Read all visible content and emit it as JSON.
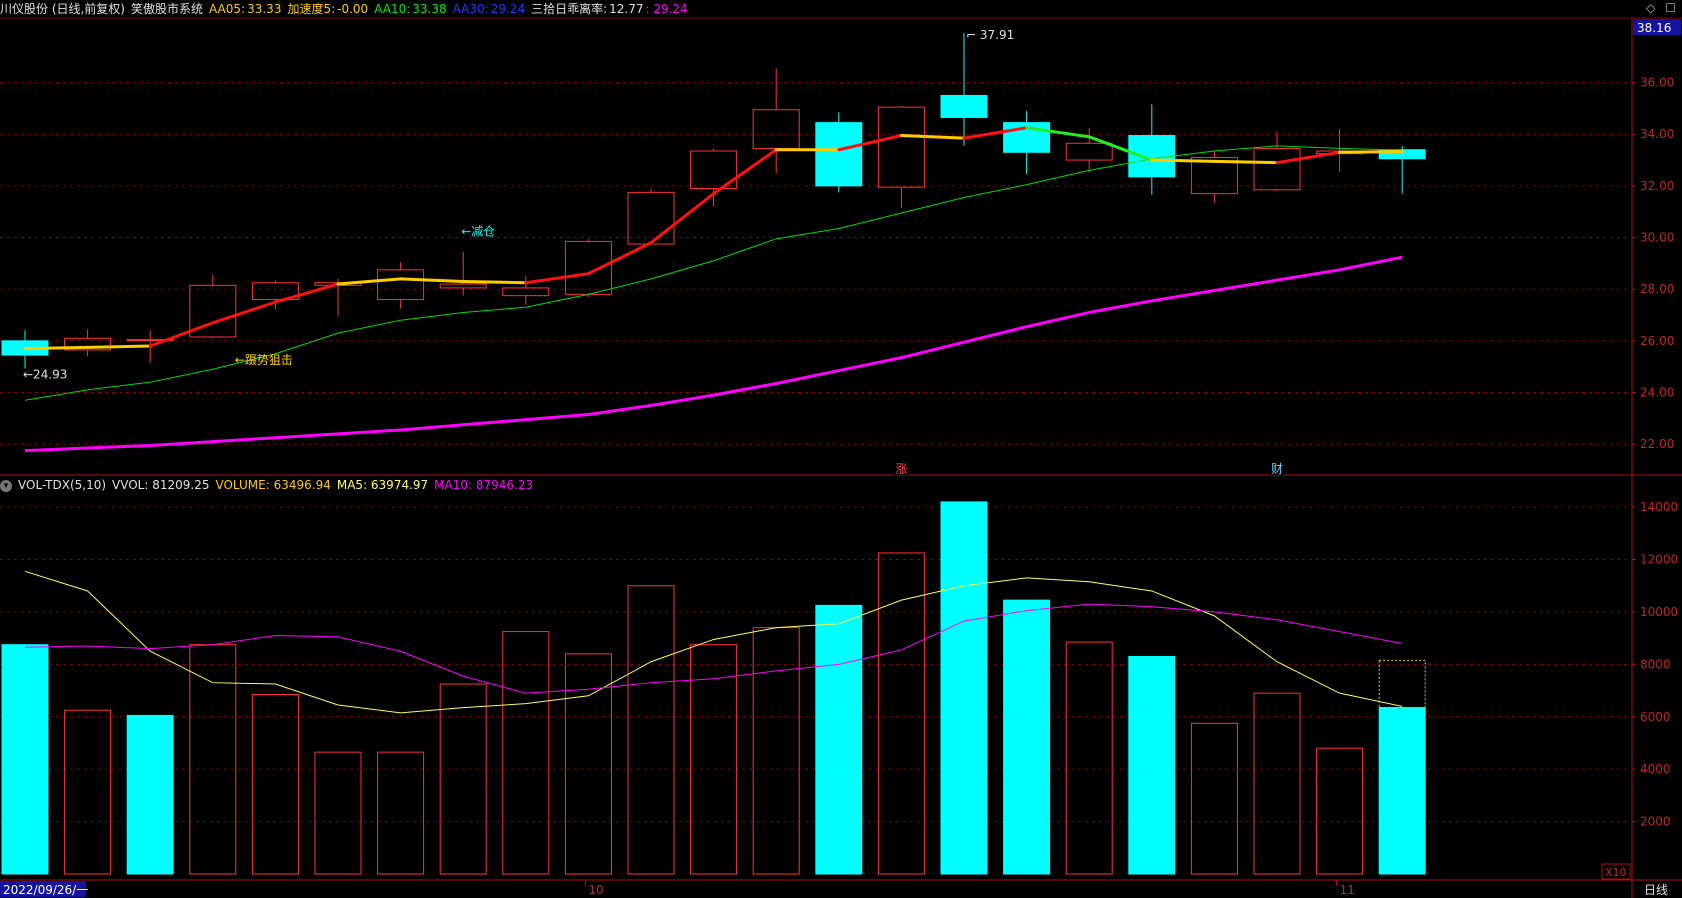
{
  "header": {
    "stock": "川仪股份 (日线,前复权)",
    "system": "笑傲股市系统",
    "aa05_label": "AA05:",
    "aa05": "33.33",
    "speed_label": "加速度5:",
    "speed": "-0.00",
    "aa10_label": "AA10:",
    "aa10": "33.38",
    "aa30_label": "AA30:",
    "aa30": "29.24",
    "bias_label": "三拾日乖离率:",
    "bias": "12.77",
    "bias2": ": 29.24",
    "icons": [
      "diamond-icon",
      "square-icon"
    ]
  },
  "volume_header": {
    "name": "VOL-TDX(5,10)",
    "vvol": "VVOL: 81209.25",
    "volume": "VOLUME: 63496.94",
    "ma5": "MA5: 63974.97",
    "ma10": "MA10: 87946.23"
  },
  "colors": {
    "up": "#ff3232",
    "down": "#00ffff",
    "ma5_line": "#ffcc00",
    "ma10_line": "#00dd00",
    "ma30_line": "#ff00ff",
    "grid": "#8b0000",
    "axis_text": "#c0281e"
  },
  "chart_data": [
    {
      "type": "candlestick",
      "title": "川仪股份 (日线,前复权)",
      "ylim": [
        21,
        38.5
      ],
      "y_ticks": [
        "22.00",
        "24.00",
        "26.00",
        "28.00",
        "30.00",
        "32.00",
        "34.00",
        "36.00"
      ],
      "last_price_tag": "38.16",
      "annotations": [
        {
          "text": "←24.93",
          "index": 0,
          "value": 24.93
        },
        {
          "text": "37.91",
          "index": 15,
          "value": 37.91
        },
        {
          "text": "←蹑势狙击",
          "index": 3,
          "value": 25.8
        },
        {
          "text": "←减仓",
          "index": 7,
          "value": 30.0
        },
        {
          "text": "涨",
          "index": 14,
          "value": 21.4
        },
        {
          "text": "财",
          "index": 20,
          "value": 21.4
        }
      ],
      "candles": [
        {
          "date": "2022/09/26",
          "open": 26.0,
          "close": 25.45,
          "high": 26.4,
          "low": 24.93
        },
        {
          "open": 25.65,
          "close": 26.1,
          "high": 26.45,
          "low": 25.4
        },
        {
          "open": 26.05,
          "close": 26.05,
          "high": 26.4,
          "low": 25.15
        },
        {
          "open": 26.15,
          "close": 28.15,
          "high": 28.55,
          "low": 26.1
        },
        {
          "open": 27.6,
          "close": 28.25,
          "high": 28.35,
          "low": 27.2
        },
        {
          "open": 28.15,
          "close": 28.25,
          "high": 28.4,
          "low": 26.95
        },
        {
          "open": 27.6,
          "close": 28.75,
          "high": 29.05,
          "low": 27.25
        },
        {
          "open": 28.05,
          "close": 28.2,
          "high": 29.45,
          "low": 27.75
        },
        {
          "open": 27.75,
          "close": 28.05,
          "high": 28.5,
          "low": 27.4
        },
        {
          "date": "10",
          "open": 27.8,
          "close": 29.85,
          "high": 29.95,
          "low": 27.7
        },
        {
          "open": 29.75,
          "close": 31.75,
          "high": 31.9,
          "low": 29.75
        },
        {
          "open": 31.9,
          "close": 33.35,
          "high": 33.45,
          "low": 31.2
        },
        {
          "open": 33.45,
          "close": 34.95,
          "high": 36.55,
          "low": 32.5
        },
        {
          "open": 34.45,
          "close": 32.0,
          "high": 34.85,
          "low": 31.75
        },
        {
          "open": 31.95,
          "close": 35.05,
          "high": 35.1,
          "low": 31.15
        },
        {
          "open": 35.5,
          "close": 34.65,
          "high": 37.91,
          "low": 33.55
        },
        {
          "open": 34.45,
          "close": 33.3,
          "high": 34.9,
          "low": 32.45
        },
        {
          "open": 33.0,
          "close": 33.65,
          "high": 34.25,
          "low": 32.55
        },
        {
          "open": 33.95,
          "close": 32.35,
          "high": 35.15,
          "low": 31.65
        },
        {
          "open": 31.7,
          "close": 33.1,
          "high": 33.35,
          "low": 31.35
        },
        {
          "open": 31.85,
          "close": 33.45,
          "high": 34.1,
          "low": 31.8
        },
        {
          "date": "11",
          "open": 33.25,
          "close": 33.35,
          "high": 34.2,
          "low": 32.55
        },
        {
          "open": 33.4,
          "close": 33.05,
          "high": 33.55,
          "low": 31.7
        }
      ],
      "series": [
        {
          "name": "AA05",
          "values": [
            25.7,
            25.75,
            25.8,
            26.7,
            27.5,
            28.2,
            28.4,
            28.3,
            28.25,
            28.6,
            29.8,
            31.7,
            33.4,
            33.4,
            33.95,
            33.85,
            34.25,
            33.9,
            33.0,
            32.95,
            32.9,
            33.3,
            33.33
          ]
        },
        {
          "name": "AA10",
          "values": [
            23.7,
            24.1,
            24.4,
            24.9,
            25.5,
            26.3,
            26.8,
            27.1,
            27.3,
            27.8,
            28.4,
            29.1,
            29.95,
            30.35,
            30.95,
            31.55,
            32.05,
            32.6,
            33.05,
            33.35,
            33.55,
            33.45,
            33.38
          ]
        },
        {
          "name": "AA30",
          "values": [
            21.75,
            21.85,
            21.95,
            22.1,
            22.25,
            22.4,
            22.55,
            22.75,
            22.95,
            23.15,
            23.5,
            23.9,
            24.35,
            24.85,
            25.35,
            25.95,
            26.55,
            27.1,
            27.55,
            27.95,
            28.35,
            28.75,
            29.24
          ]
        }
      ]
    },
    {
      "type": "bar",
      "title": "VOL-TDX(5,10)",
      "ylim": [
        0,
        14500
      ],
      "y_ticks": [
        "2000",
        "4000",
        "6000",
        "8000",
        "10000",
        "12000",
        "14000"
      ],
      "scale_label": "X10",
      "values": [
        8750,
        6250,
        6050,
        8750,
        6850,
        4650,
        4650,
        7250,
        9250,
        8400,
        11000,
        8750,
        9400,
        10250,
        12250,
        14200,
        10450,
        8850,
        8300,
        5750,
        6900,
        4800,
        6350
      ],
      "up": [
        false,
        true,
        false,
        true,
        true,
        true,
        true,
        true,
        true,
        true,
        true,
        true,
        true,
        false,
        true,
        false,
        false,
        true,
        false,
        true,
        true,
        true,
        false
      ],
      "projected_last": 8150,
      "series": [
        {
          "name": "MA5",
          "values": [
            11550,
            10800,
            8500,
            7300,
            7250,
            6450,
            6150,
            6350,
            6500,
            6800,
            8100,
            8950,
            9400,
            9550,
            10450,
            11000,
            11300,
            11150,
            10800,
            9850,
            8100,
            6900,
            6397
          ]
        },
        {
          "name": "MA10",
          "values": [
            8650,
            8700,
            8600,
            8750,
            9100,
            9050,
            8500,
            7550,
            6900,
            7050,
            7300,
            7450,
            7750,
            8000,
            8550,
            9650,
            10050,
            10300,
            10200,
            10000,
            9700,
            9250,
            8795
          ]
        }
      ]
    }
  ],
  "x_axis": {
    "labels": [
      "2022/09/26/一",
      "10",
      "11",
      "日线"
    ]
  }
}
